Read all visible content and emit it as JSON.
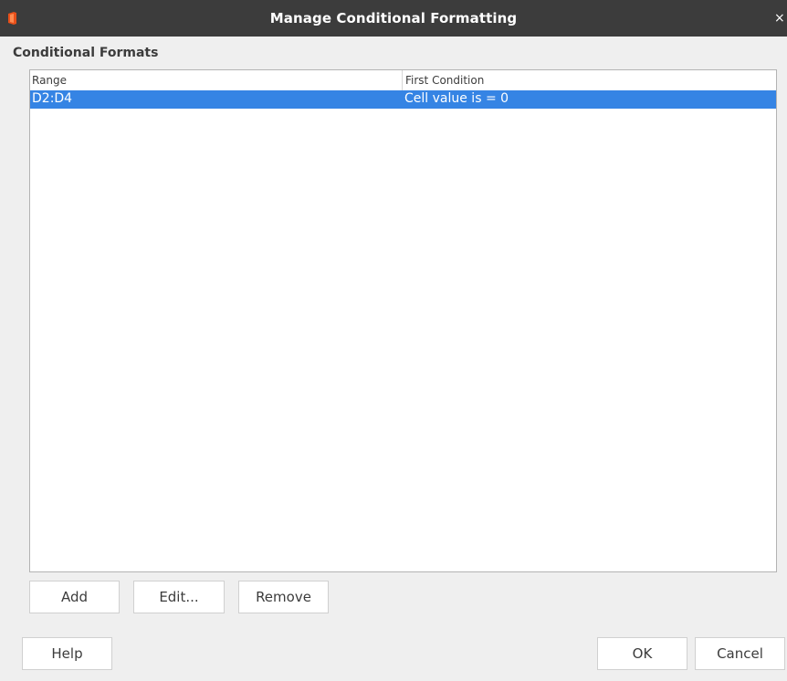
{
  "window": {
    "title": "Manage Conditional Formatting",
    "close_glyph": "×",
    "app_icon": "libreoffice-icon"
  },
  "section": {
    "label": "Conditional Formats"
  },
  "list": {
    "columns": [
      "Range",
      "First Condition"
    ],
    "rows": [
      {
        "range": "D2:D4",
        "condition": "Cell value is = 0",
        "selected": true
      }
    ]
  },
  "list_buttons": {
    "add": "Add",
    "edit": "Edit...",
    "remove": "Remove"
  },
  "footer_buttons": {
    "help": "Help",
    "ok": "OK",
    "cancel": "Cancel"
  },
  "colors": {
    "titlebar": "#3c3c3c",
    "selection": "#3584e4",
    "app_icon": "#e8501a"
  }
}
